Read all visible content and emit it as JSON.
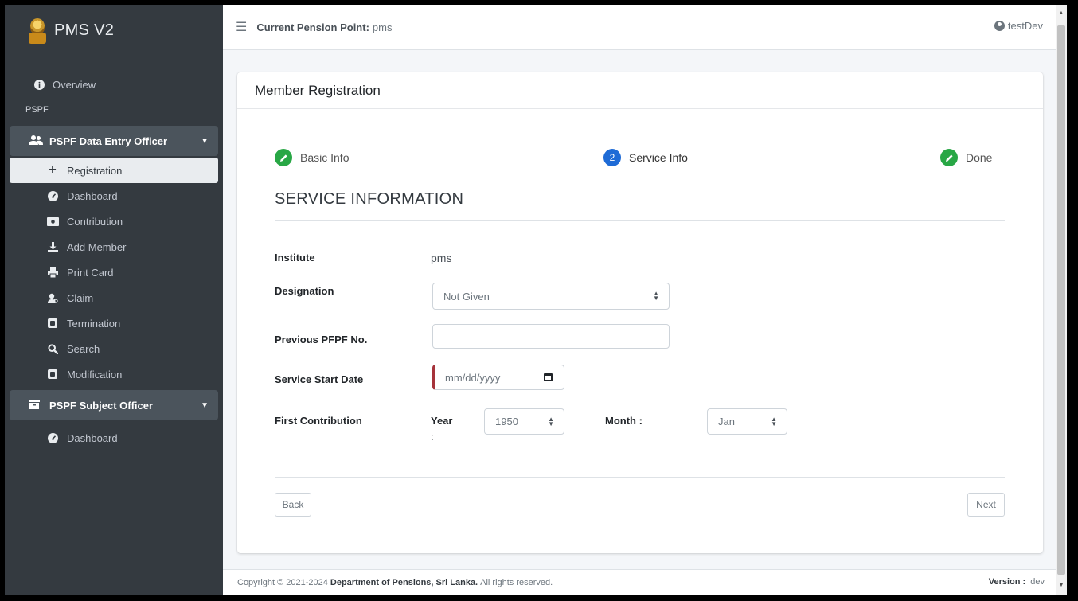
{
  "brand": {
    "title": "PMS V2"
  },
  "sidebar": {
    "overview": "Overview",
    "section": "PSPF",
    "group1": {
      "label": "PSPF Data Entry Officer",
      "items": [
        {
          "label": "Registration",
          "icon": "plus-icon"
        },
        {
          "label": "Dashboard",
          "icon": "dashboard-icon"
        },
        {
          "label": "Contribution",
          "icon": "money-icon"
        },
        {
          "label": "Add Member",
          "icon": "download-icon"
        },
        {
          "label": "Print Card",
          "icon": "print-icon"
        },
        {
          "label": "Claim",
          "icon": "user-search-icon"
        },
        {
          "label": "Termination",
          "icon": "file-icon"
        },
        {
          "label": "Search",
          "icon": "search-icon"
        },
        {
          "label": "Modification",
          "icon": "file-icon"
        }
      ]
    },
    "group2": {
      "label": "PSPF Subject Officer",
      "items": [
        {
          "label": "Dashboard",
          "icon": "dashboard-icon"
        }
      ]
    }
  },
  "topbar": {
    "pension_point_label": "Current Pension Point:",
    "pension_point_value": "pms",
    "user": "testDev"
  },
  "card": {
    "title": "Member Registration",
    "steps": [
      {
        "label": "Basic Info",
        "state": "done"
      },
      {
        "label": "Service Info",
        "state": "current",
        "number": "2"
      },
      {
        "label": "Done",
        "state": "done"
      }
    ],
    "section_title": "SERVICE INFORMATION",
    "form": {
      "institute_label": "Institute",
      "institute_value": "pms",
      "designation_label": "Designation",
      "designation_value": "Not Given",
      "prev_pfpf_label": "Previous PFPF No.",
      "prev_pfpf_value": "",
      "start_date_label": "Service Start Date",
      "start_date_placeholder": "mm/dd/yyyy",
      "first_contribution_label": "First Contribution",
      "year_label": "Year",
      "year_colon": ":",
      "year_value": "1950",
      "month_label": "Month :",
      "month_value": "Jan"
    },
    "back_label": "Back",
    "next_label": "Next"
  },
  "footer": {
    "copyright_prefix": "Copyright © 2021-2024",
    "org": "Department of Pensions, Sri Lanka.",
    "rights": "All rights reserved.",
    "version_label": "Version :",
    "version_value": "dev"
  },
  "colors": {
    "sidebar_bg": "#343a40",
    "step_done": "#28a745",
    "step_current": "#1e6bd6",
    "date_accent": "#a6333b"
  }
}
